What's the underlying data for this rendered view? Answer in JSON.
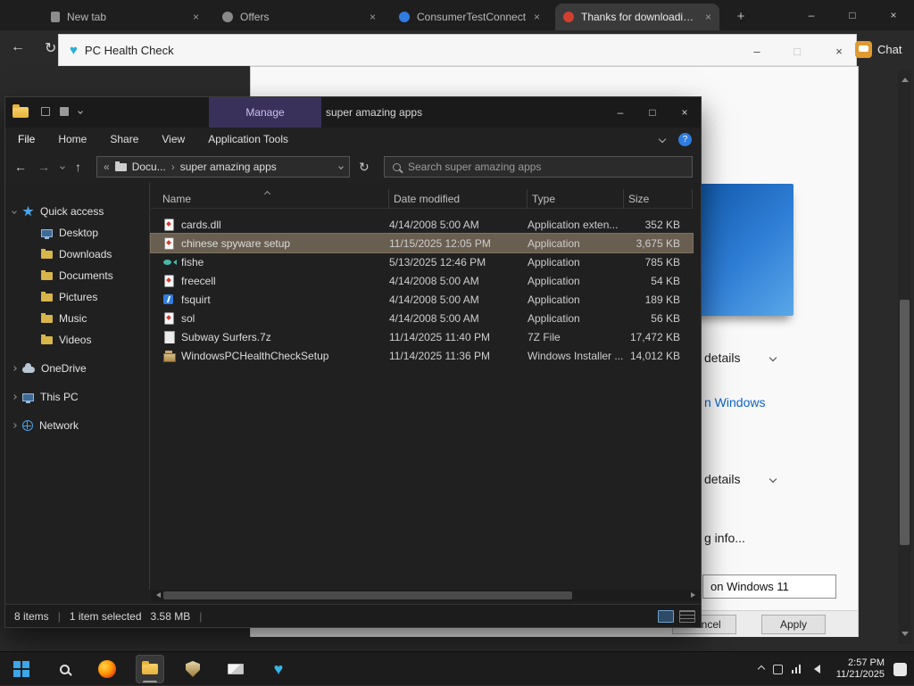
{
  "icons": {
    "back": "←",
    "forward": "→",
    "up_arrow": "↑",
    "refresh": "↻",
    "overflow": "«",
    "breadcrumb_separator": "›",
    "minimize": "–",
    "maximize": "□",
    "close": "×",
    "new_tab": "+",
    "help": "?",
    "heart": "♥"
  },
  "browser": {
    "tabs": [
      {
        "label": "New tab"
      },
      {
        "label": "Offers"
      },
      {
        "label": "ConsumerTestConnect"
      },
      {
        "label": "Thanks for downloading..."
      }
    ],
    "chat_label": "Chat"
  },
  "pc_health_check": {
    "title": "PC Health Check",
    "details_row_1": "details",
    "windows_link": "n Windows",
    "details_row_2": "details",
    "info_text": "g info...",
    "windows11_box": "on Windows 11",
    "cancel_button": "Cancel",
    "apply_button": "Apply"
  },
  "explorer": {
    "title": "super amazing apps",
    "manage_tab": "Manage",
    "ribbon_tabs": [
      {
        "label": "File"
      },
      {
        "label": "Home"
      },
      {
        "label": "Share"
      },
      {
        "label": "View"
      },
      {
        "label": "Application Tools"
      }
    ],
    "address": {
      "segment_1": "Docu...",
      "segment_2": "super amazing apps"
    },
    "search_placeholder": "Search super amazing apps",
    "sidebar": {
      "items": [
        {
          "label": "Quick access"
        },
        {
          "label": "Desktop"
        },
        {
          "label": "Downloads"
        },
        {
          "label": "Documents"
        },
        {
          "label": "Pictures"
        },
        {
          "label": "Music"
        },
        {
          "label": "Videos"
        },
        {
          "label": "OneDrive"
        },
        {
          "label": "This PC"
        },
        {
          "label": "Network"
        }
      ]
    },
    "columns": [
      {
        "label": "Name"
      },
      {
        "label": "Date modified"
      },
      {
        "label": "Type"
      },
      {
        "label": "Size"
      }
    ],
    "files": [
      {
        "name": "cards.dll",
        "date_modified": "4/14/2008 5:00 AM",
        "type": "Application exten...",
        "size": "352 KB"
      },
      {
        "name": "chinese spyware setup",
        "date_modified": "11/15/2025 12:05 PM",
        "type": "Application",
        "size": "3,675 KB"
      },
      {
        "name": "fishe",
        "date_modified": "5/13/2025 12:46 PM",
        "type": "Application",
        "size": "785 KB"
      },
      {
        "name": "freecell",
        "date_modified": "4/14/2008 5:00 AM",
        "type": "Application",
        "size": "54 KB"
      },
      {
        "name": "fsquirt",
        "date_modified": "4/14/2008 5:00 AM",
        "type": "Application",
        "size": "189 KB"
      },
      {
        "name": "sol",
        "date_modified": "4/14/2008 5:00 AM",
        "type": "Application",
        "size": "56 KB"
      },
      {
        "name": "Subway Surfers.7z",
        "date_modified": "11/14/2025 11:40 PM",
        "type": "7Z File",
        "size": "17,472 KB"
      },
      {
        "name": "WindowsPCHealthCheckSetup",
        "date_modified": "11/14/2025 11:36 PM",
        "type": "Windows Installer ...",
        "size": "14,012 KB"
      }
    ],
    "status": {
      "items_count": "8 items",
      "separator": "|",
      "selection": "1 item selected",
      "selection_size": "3.58 MB"
    }
  },
  "taskbar": {
    "clock": {
      "time": "2:57 PM",
      "date": "11/21/2025"
    }
  }
}
